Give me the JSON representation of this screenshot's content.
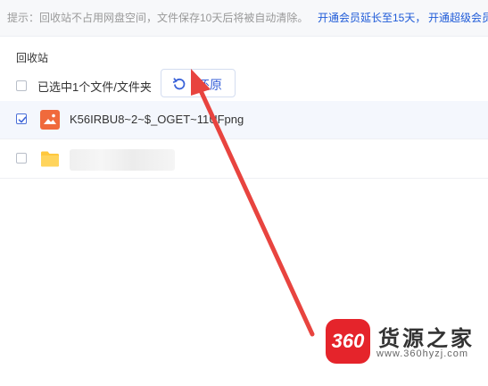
{
  "notice": {
    "tip": "提示：回收站不占用网盘空间，文件保存10天后将被自动清除。",
    "link_extend": "开通会员延长至15天，",
    "link_super": "开通超级会员"
  },
  "breadcrumb": "回收站",
  "toolbar": {
    "selected_text": "已选中1个文件/文件夹",
    "restore_label": "还原"
  },
  "files": [
    {
      "name": "K56IRBU8~2~$_OGET~11UFpng",
      "type": "image",
      "checked": true
    },
    {
      "name": "",
      "type": "folder",
      "checked": false
    }
  ],
  "colors": {
    "accent": "#3b63d9",
    "link": "#1f5bd8",
    "arrow": "#e8443f",
    "image_icon": "#f06a3c",
    "folder_icon": "#ffc83d"
  },
  "watermark": {
    "logo": "360",
    "brand": "货源之家",
    "url": "www.360hyzj.com"
  }
}
